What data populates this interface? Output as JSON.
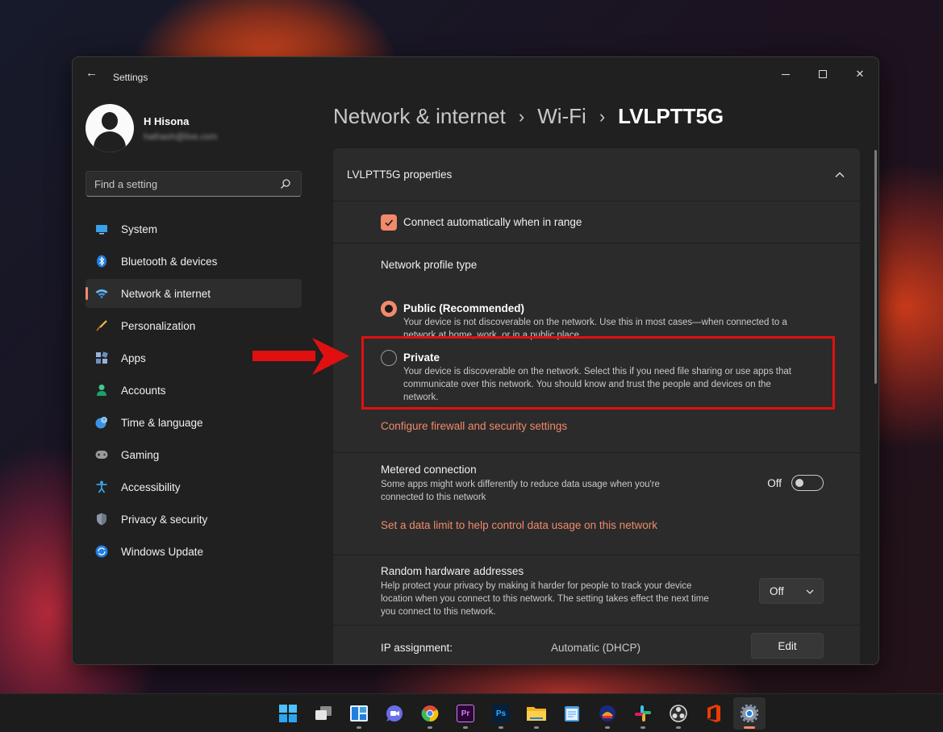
{
  "window": {
    "title": "Settings"
  },
  "user": {
    "name": "H Hisona",
    "email": "hathaoh@live.com"
  },
  "search": {
    "placeholder": "Find a setting"
  },
  "nav": {
    "items": [
      {
        "label": "System",
        "icon": "monitor-icon"
      },
      {
        "label": "Bluetooth & devices",
        "icon": "bluetooth-icon"
      },
      {
        "label": "Network & internet",
        "icon": "wifi-icon",
        "active": true
      },
      {
        "label": "Personalization",
        "icon": "brush-icon"
      },
      {
        "label": "Apps",
        "icon": "apps-icon"
      },
      {
        "label": "Accounts",
        "icon": "person-icon"
      },
      {
        "label": "Time & language",
        "icon": "clock-globe-icon"
      },
      {
        "label": "Gaming",
        "icon": "gamepad-icon"
      },
      {
        "label": "Accessibility",
        "icon": "accessibility-icon"
      },
      {
        "label": "Privacy & security",
        "icon": "shield-icon"
      },
      {
        "label": "Windows Update",
        "icon": "update-icon"
      }
    ]
  },
  "breadcrumb": {
    "level1": "Network & internet",
    "level2": "Wi-Fi",
    "current": "LVLPTT5G"
  },
  "properties": {
    "header": "LVLPTT5G properties",
    "auto_connect": {
      "label": "Connect automatically when in range",
      "checked": true
    },
    "profile": {
      "title": "Network profile type",
      "public": {
        "title": "Public (Recommended)",
        "desc_line1": "Your device is not discoverable on the network. Use this in most cases—when connected to a",
        "desc_line2": "network at home, work, or in a public place.",
        "selected": true
      },
      "private": {
        "title": "Private",
        "desc_line1": "Your device is discoverable on the network. Select this if you need file sharing or use apps that",
        "desc_line2": "communicate over this network. You should know and trust the people and devices on the",
        "desc_line3": "network.",
        "selected": false
      },
      "firewall_link": "Configure firewall and security settings"
    },
    "metered": {
      "title": "Metered connection",
      "desc_line1": "Some apps might work differently to reduce data usage when you're",
      "desc_line2": "connected to this network",
      "toggle_label": "Off",
      "toggle_on": false,
      "data_limit_link": "Set a data limit to help control data usage on this network"
    },
    "random_hw": {
      "title": "Random hardware addresses",
      "desc_line1": "Help protect your privacy by making it harder for people to track your device",
      "desc_line2": "location when you connect to this network. The setting takes effect the next time",
      "desc_line3": "you connect to this network.",
      "value": "Off"
    },
    "ip": {
      "label": "IP assignment:",
      "value": "Automatic (DHCP)",
      "edit_label": "Edit"
    }
  },
  "colors": {
    "accent": "#f08a6a",
    "annotation": "#e01010",
    "window_bg": "#202020",
    "card_bg": "#2b2b2b"
  },
  "taskbar": {
    "icons": [
      "start-icon",
      "task-view-icon",
      "widgets-icon",
      "teams-chat-icon",
      "chrome-icon",
      "premiere-icon",
      "photoshop-icon",
      "file-explorer-icon",
      "notepad-icon",
      "app-icon",
      "slack-icon",
      "obs-icon",
      "office-icon",
      "settings-icon"
    ],
    "premiere_label": "Pr",
    "photoshop_label": "Ps"
  }
}
